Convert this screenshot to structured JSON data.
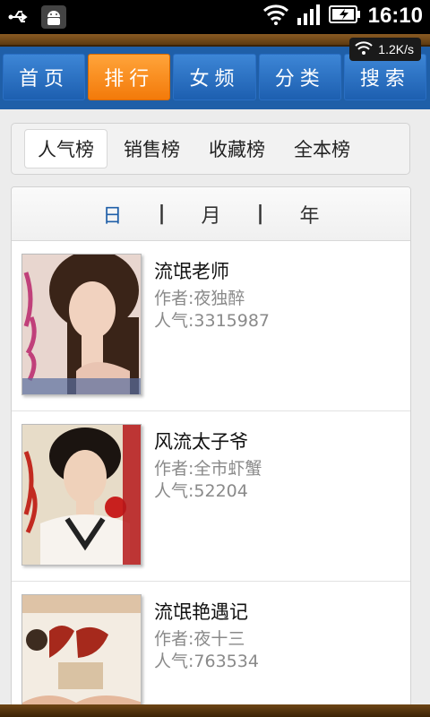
{
  "status_bar": {
    "time": "16:10",
    "speed": "1.2K/s"
  },
  "nav": {
    "tabs": [
      {
        "label": "首页",
        "active": false
      },
      {
        "label": "排行",
        "active": true
      },
      {
        "label": "女频",
        "active": false
      },
      {
        "label": "分类",
        "active": false
      },
      {
        "label": "搜索",
        "active": false
      }
    ]
  },
  "ranking_tabs": [
    {
      "label": "人气榜",
      "active": true
    },
    {
      "label": "销售榜",
      "active": false
    },
    {
      "label": "收藏榜",
      "active": false
    },
    {
      "label": "全本榜",
      "active": false
    }
  ],
  "periods": [
    {
      "label": "日",
      "active": true
    },
    {
      "label": "月",
      "active": false
    },
    {
      "label": "年",
      "active": false
    }
  ],
  "period_separator": "|",
  "books": [
    {
      "title": "流氓老师",
      "author": "作者:夜独醉",
      "popularity": "人气:3315987"
    },
    {
      "title": "风流太子爷",
      "author": "作者:全市虾蟹",
      "popularity": "人气:52204"
    },
    {
      "title": "流氓艳遇记",
      "author": "作者:夜十三",
      "popularity": "人气:763534"
    }
  ],
  "colors": {
    "nav_bg": "#1f5fa8",
    "active_tab": "#f37a0a",
    "period_active": "#1f5fa8"
  }
}
